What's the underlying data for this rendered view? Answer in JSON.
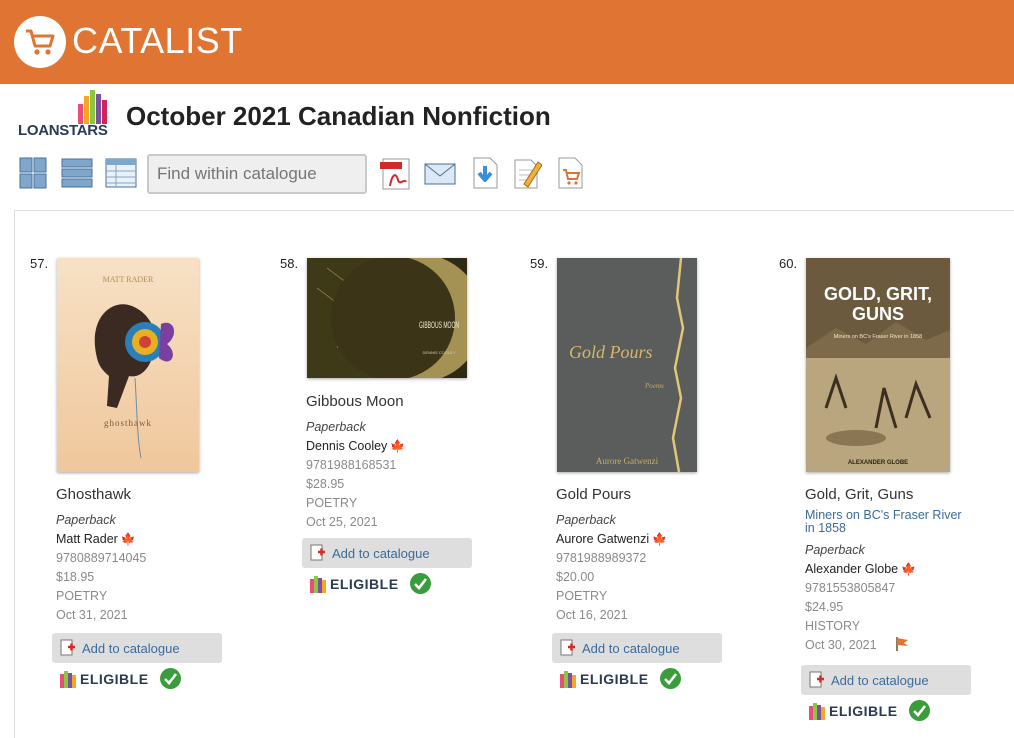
{
  "header": {
    "brand": "CATALIST"
  },
  "catalogue": {
    "logo_text": "LOANSTARS",
    "title": "October 2021 Canadian Nonfiction"
  },
  "toolbar": {
    "search_placeholder": "Find within catalogue",
    "icons": [
      "grid-view-icon",
      "list-view-icon",
      "table-view-icon",
      "pdf-icon",
      "email-icon",
      "download-icon",
      "edit-icon",
      "cart-icon"
    ]
  },
  "books": [
    {
      "num": "57.",
      "title": "Ghosthawk",
      "subtitle": "",
      "format": "Paperback",
      "author": "Matt Rader",
      "isbn": "9780889714045",
      "price": "$18.95",
      "category": "POETRY",
      "date": "Oct 31, 2021",
      "add_label": "Add to catalogue",
      "eligible_label": "ELIGIBLE"
    },
    {
      "num": "58.",
      "title": "Gibbous Moon",
      "subtitle": "",
      "format": "Paperback",
      "author": "Dennis Cooley",
      "isbn": "9781988168531",
      "price": "$28.95",
      "category": "POETRY",
      "date": "Oct 25, 2021",
      "add_label": "Add to catalogue",
      "eligible_label": "ELIGIBLE"
    },
    {
      "num": "59.",
      "title": "Gold Pours",
      "subtitle": "",
      "format": "Paperback",
      "author": "Aurore Gatwenzi",
      "isbn": "9781988989372",
      "price": "$20.00",
      "category": "POETRY",
      "date": "Oct 16, 2021",
      "add_label": "Add to catalogue",
      "eligible_label": "ELIGIBLE"
    },
    {
      "num": "60.",
      "title": "Gold, Grit, Guns",
      "subtitle": "Miners on BC's Fraser River in 1858",
      "format": "Paperback",
      "author": "Alexander Globe",
      "isbn": "9781553805847",
      "price": "$24.95",
      "category": "HISTORY",
      "date": "Oct 30, 2021",
      "add_label": "Add to catalogue",
      "eligible_label": "ELIGIBLE"
    }
  ],
  "covers": {
    "ghosthawk": {
      "title": "ghosthawk",
      "author": "MATT RADER"
    },
    "gibbous": {
      "title": "GIBBOUS MOON",
      "author": "DENNIS COOLEY"
    },
    "gold_pours": {
      "title": "Gold Pours",
      "subtitle": "Poems",
      "author": "Aurore Gatwenzi"
    },
    "ggg": {
      "title_line1": "GOLD, GRIT,",
      "title_line2": "GUNS",
      "subtitle": "Miners on BC's Fraser River in 1858",
      "author": "ALEXANDER GLOBE"
    }
  }
}
